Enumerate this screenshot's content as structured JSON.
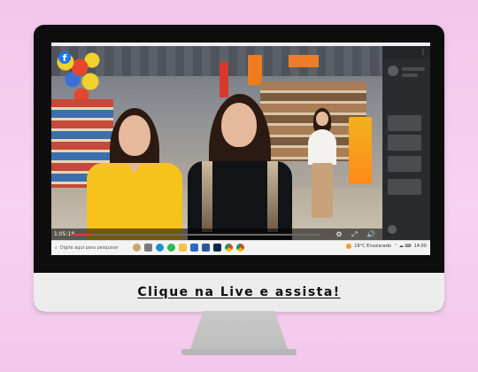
{
  "cta": {
    "text": "Clique na Live e assista!"
  },
  "video": {
    "platform_icon": "facebook-icon",
    "elapsed": "1:05:18",
    "progress": 0.08
  },
  "taskbar": {
    "search_placeholder": "Digite aqui para pesquisar",
    "weather": "19°C Ensolarado",
    "time": "14:00"
  },
  "colors": {
    "background": "#f3c6ec",
    "monitor_bezel": "#0d0d0d",
    "monitor_chin": "#ececec",
    "stand": "#c4c4c4",
    "facebook_blue": "#1877f2",
    "uniform_yellow": "#f7c21b"
  }
}
